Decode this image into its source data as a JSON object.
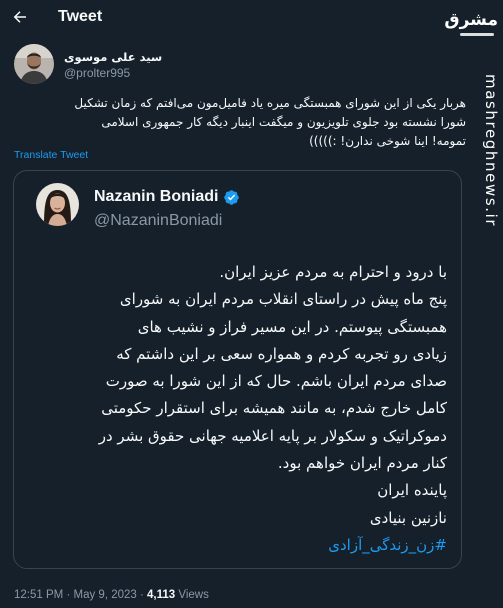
{
  "header": {
    "back_icon": "arrow-left-icon",
    "title": "Tweet"
  },
  "watermark": {
    "logo_text": "مشرق",
    "site": "mashreghnews.ir"
  },
  "tweet": {
    "author": {
      "name": "سید علی موسوی",
      "handle": "@prolter995",
      "avatar_icon": "user-avatar"
    },
    "text_lines": [
      "هربار یکی از این شورای همبستگی میره یاد فامیل‌مون می‌افتم که زمان تشکیل",
      "شورا نشسته بود جلوی تلویزیون و میگفت اینبار دیگه کار جمهوری اسلامی",
      "تمومه! اینا شوخی ندارن! :)))))"
    ],
    "translate_label": "Translate Tweet",
    "quote": {
      "author": {
        "name": "Nazanin Boniadi",
        "handle": "@NazaninBoniadi",
        "verified": true,
        "verified_icon": "verified-badge-icon"
      },
      "lines": [
        "با درود و احترام به مردم عزیز ایران.",
        "پنج ماه پیش در راستای انقلاب مردم ایران به شورای",
        "همبستگی پیوستم. در این مسیر فراز و نشیب های",
        "زیادی رو تجربه کردم و همواره سعی بر این داشتم که",
        "صدای مردم ایران باشم. حال که از این شورا به صورت",
        "کامل خارج شدم، به مانند همیشه برای استقرار حکومتی",
        "دموکراتیک و سکولار بر پایه اعلامیه جهانی حقوق بشر در",
        "کنار مردم ایران خواهم بود.",
        "پاینده ایران",
        "نازنین بنیادی"
      ],
      "hashtag": "#زن_زندگی_آزادی"
    },
    "meta": {
      "time": "12:51 PM",
      "separator": "·",
      "date": "May 9, 2023",
      "views_count": "4,113",
      "views_label": "Views"
    }
  },
  "colors": {
    "background": "#15202b",
    "text": "#f7f9f9",
    "muted": "#8b98a5",
    "accent": "#1d9bf0",
    "border": "#38444d"
  }
}
